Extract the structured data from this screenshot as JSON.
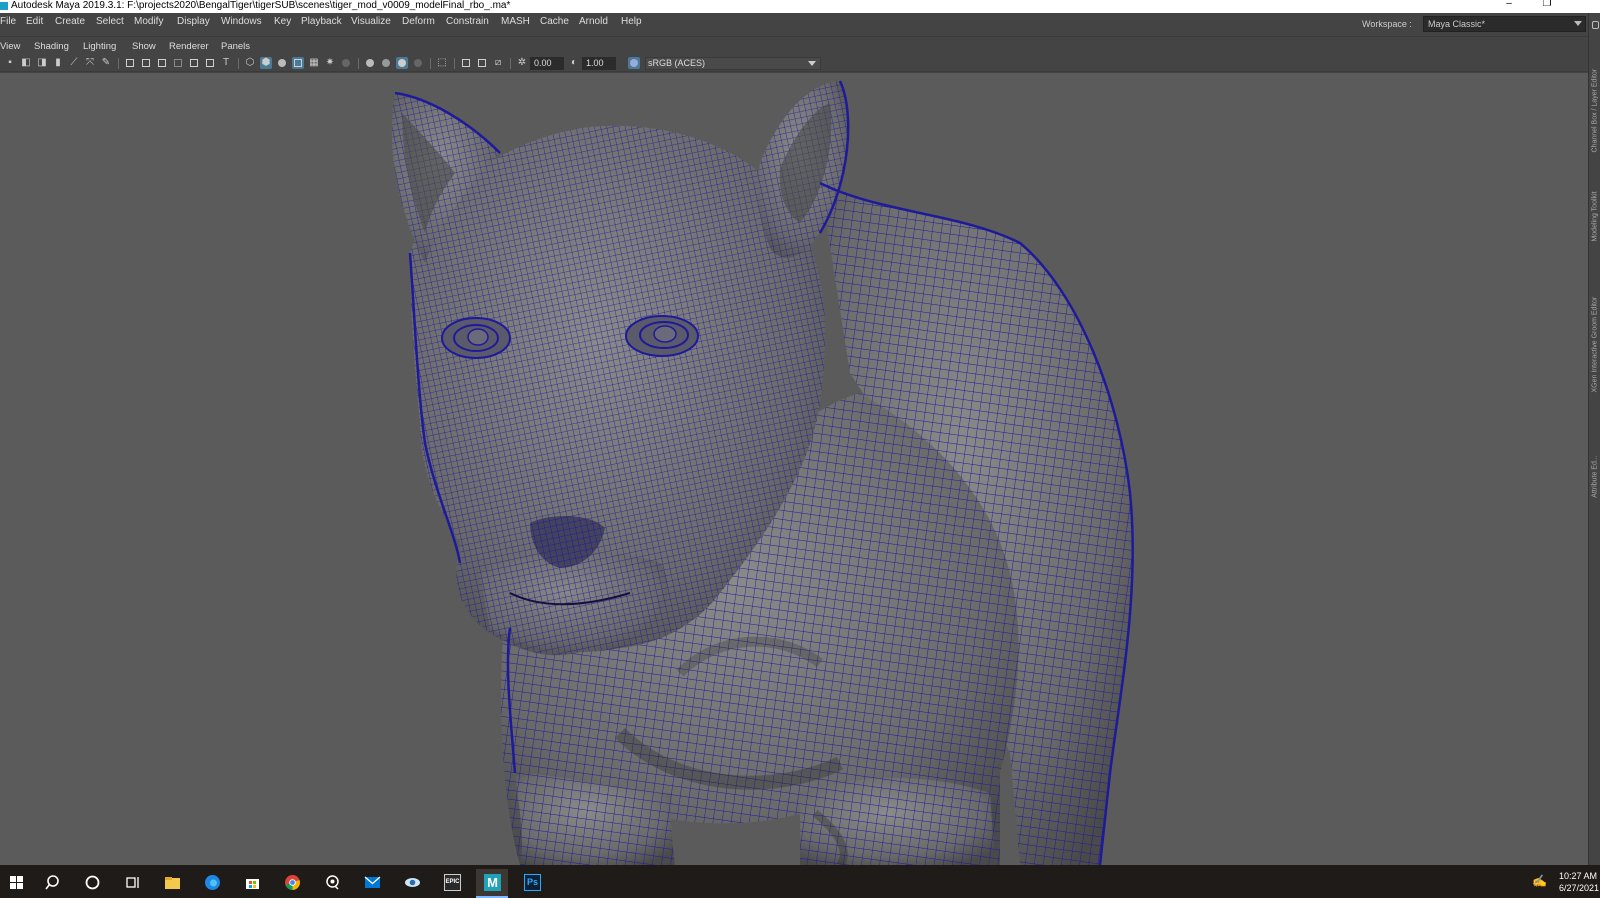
{
  "window": {
    "title": "Autodesk Maya 2019.3.1: F:\\projects2020\\BengalTiger\\tigerSUB\\scenes\\tiger_mod_v0009_modelFinal_rbo_.ma*",
    "minimize": "–",
    "restore": "❐"
  },
  "menubar": {
    "items": [
      "File",
      "Edit",
      "Create",
      "Select",
      "Modify",
      "Display",
      "Windows",
      "Key",
      "Playback",
      "Visualize",
      "Deform",
      "Constrain",
      "MASH",
      "Cache",
      "Arnold",
      "Help"
    ],
    "workspace_label": "Workspace :",
    "workspace_value": "Maya Classic*"
  },
  "panel_menu": {
    "items": [
      "View",
      "Shading",
      "Lighting",
      "Show",
      "Renderer",
      "Panels"
    ]
  },
  "panel_toolbar": {
    "exposure": "0.00",
    "gamma": "1.00",
    "color_space": "sRGB (ACES)"
  },
  "side_tabs": [
    "Channel Box / Layer Editor",
    "Modeling Toolkit",
    "XGen Interactive Groom Editor",
    "Attribute Ed..."
  ],
  "taskbar": {
    "apps": [
      "start-icon",
      "search-icon",
      "cortana-icon",
      "task-view-icon",
      "file-explorer-icon",
      "edge-icon",
      "store-icon",
      "chrome-icon",
      "feedback-hub-icon",
      "mail-icon",
      "eye-app-icon",
      "epic-games-icon",
      "maya-icon",
      "photoshop-icon"
    ],
    "epic_label": "EPIC",
    "maya_label": "M",
    "ps_label": "Ps",
    "time": "10:27 AM",
    "date": "6/27/2021"
  },
  "colors": {
    "viewport_bg": "#5b5b5b",
    "wireframe": "#1f1a9a",
    "ui_bg": "#444444",
    "highlight": "#4a7b96"
  }
}
